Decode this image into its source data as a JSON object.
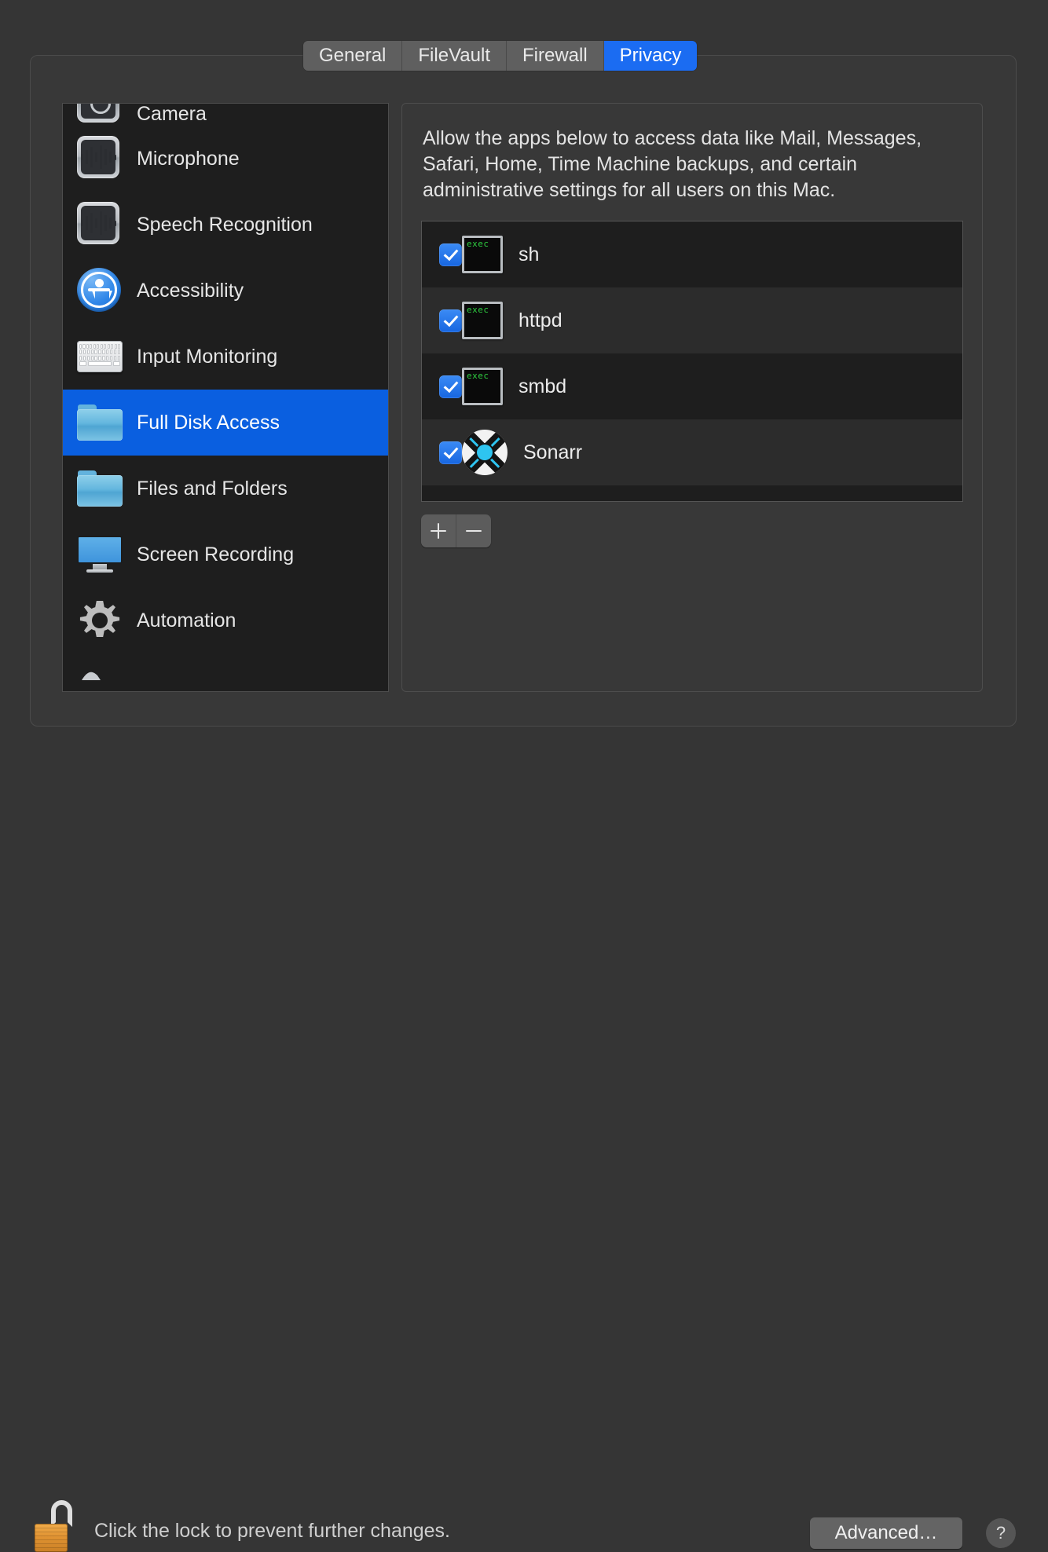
{
  "tabs": [
    {
      "label": "General",
      "active": false
    },
    {
      "label": "FileVault",
      "active": false
    },
    {
      "label": "Firewall",
      "active": false
    },
    {
      "label": "Privacy",
      "active": true
    }
  ],
  "sidebar": {
    "items": [
      {
        "label": "Camera",
        "icon": "camera-icon",
        "selected": false,
        "clipped": true
      },
      {
        "label": "Microphone",
        "icon": "microphone-icon",
        "selected": false
      },
      {
        "label": "Speech Recognition",
        "icon": "speech-recognition-icon",
        "selected": false
      },
      {
        "label": "Accessibility",
        "icon": "accessibility-icon",
        "selected": false
      },
      {
        "label": "Input Monitoring",
        "icon": "keyboard-icon",
        "selected": false
      },
      {
        "label": "Full Disk Access",
        "icon": "folder-icon",
        "selected": true
      },
      {
        "label": "Files and Folders",
        "icon": "folder-icon",
        "selected": false
      },
      {
        "label": "Screen Recording",
        "icon": "display-icon",
        "selected": false
      },
      {
        "label": "Automation",
        "icon": "gear-icon",
        "selected": false
      }
    ]
  },
  "main": {
    "description": "Allow the apps below to access data like Mail, Messages, Safari, Home, Time Machine backups, and certain administrative settings for all users on this Mac.",
    "apps": [
      {
        "name": "sh",
        "icon": "exec-icon",
        "icon_text": "exec",
        "checked": true
      },
      {
        "name": "httpd",
        "icon": "exec-icon",
        "icon_text": "exec",
        "checked": true
      },
      {
        "name": "smbd",
        "icon": "exec-icon",
        "icon_text": "exec",
        "checked": true
      },
      {
        "name": "Sonarr",
        "icon": "sonarr-icon",
        "checked": true
      }
    ],
    "add_label": "+",
    "remove_label": "−"
  },
  "footer": {
    "lock_icon": "unlocked-padlock-icon",
    "lock_message": "Click the lock to prevent further changes.",
    "advanced_label": "Advanced…",
    "help_label": "?"
  },
  "colors": {
    "accent": "#1b6cf2",
    "selection": "#0a5fe0",
    "window_bg": "#353535",
    "list_bg": "#1e1e1e",
    "checkbox": "#2c7ef0",
    "exec_text": "#2ecc40",
    "sonarr_cyan": "#2ec4f0",
    "lock_gold": "#e19433"
  }
}
